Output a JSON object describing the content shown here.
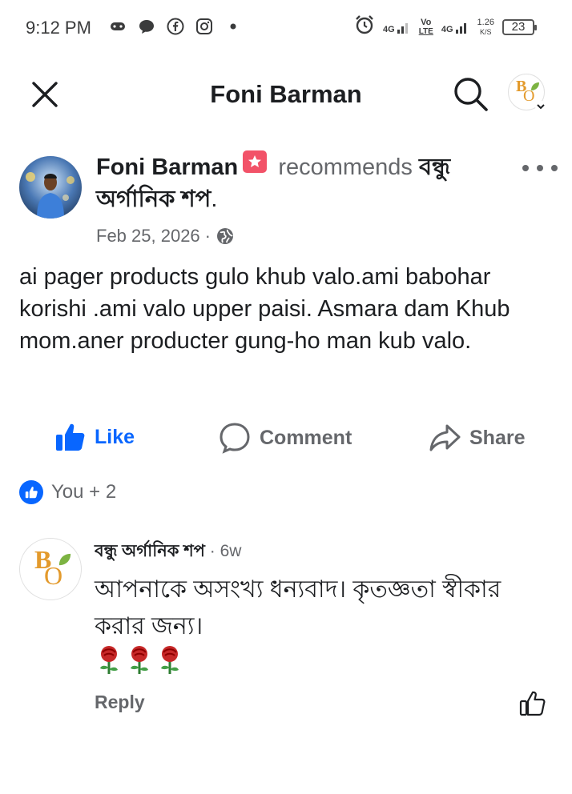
{
  "status_bar": {
    "time": "9:12 PM",
    "net1": "4G",
    "volte_top": "Vo",
    "volte_bottom": "LTE",
    "net2": "4G",
    "speed_value": "1.26",
    "speed_unit": "K/S",
    "battery": "23",
    "icons": [
      "game-controller-icon",
      "chat-bubble-icon",
      "facebook-icon",
      "instagram-icon",
      "dot-icon",
      "alarm-icon",
      "signal-icon",
      "battery-icon"
    ]
  },
  "header": {
    "title": "Foni Barman",
    "icons": [
      "close-icon",
      "search-icon",
      "page-logo-icon"
    ]
  },
  "post": {
    "author": "Foni Barman",
    "verb": "recommends",
    "page_name": "বন্ধু অর্গানিক শপ",
    "page_suffix": ".",
    "date": "Feb 25, 2026",
    "separator": "·",
    "privacy_icon": "globe-icon",
    "body": "ai pager products gulo khub valo.ami babohar korishi .ami valo upper paisi. Asmara dam Khub mom.aner producter gung-ho man kub valo."
  },
  "actions": {
    "like": "Like",
    "comment": "Comment",
    "share": "Share"
  },
  "reactions": {
    "summary": "You + 2"
  },
  "comment": {
    "author": "বন্ধু অর্গানিক শপ",
    "time": " · 6w",
    "text": "আপনাকে অসংখ্য ধন্যবাদ। কৃতজ্ঞতা স্বীকার করার জন্য।",
    "emoji": [
      "🌹",
      "🌹",
      "🌹"
    ],
    "reply": "Reply"
  },
  "logo": {
    "letter_b": "B",
    "letter_o": "O"
  },
  "colors": {
    "accent": "#0866ff",
    "muted": "#65676b",
    "recommend": "#f25268",
    "logo_orange": "#e39a2c",
    "logo_green": "#7cb342"
  }
}
